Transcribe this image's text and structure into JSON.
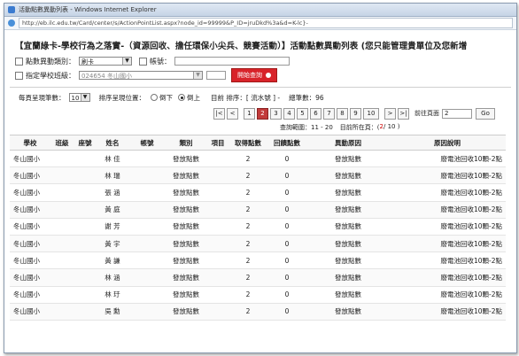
{
  "window": {
    "title": "活動點數異動列表 - Windows Internet Explorer"
  },
  "address": {
    "url": "http://eb.ilc.edu.tw/Card/center/s/ActionPointList.aspx?node_id=99999&P_ID=jruDkd%3a&d=K-lc}-"
  },
  "page": {
    "title": "【宜蘭綠卡-學校行為之落實-（資源回收、擔任環保小尖兵、競賽活動）】活動點數異動列表 (您只能管理貴單位及您新增"
  },
  "filters": {
    "type_label": "點數異動類別：",
    "type_value": "刷卡",
    "account_label": "帳號：",
    "school_label": "指定學校班級：",
    "school_value": "024654 冬山國小",
    "search_button": "開始查詢"
  },
  "options": {
    "page_size_label": "每頁呈現筆數：",
    "page_size_value": "10",
    "order_label": "排序呈現位置：",
    "order_desc": "倒下",
    "order_asc": "倒上",
    "sort_text": "目前 排序：[ 流水號 ] -",
    "total_text": "總筆數：96"
  },
  "pager": {
    "first": "|<",
    "prev": "<",
    "pages": [
      "1",
      "2",
      "3",
      "4",
      "5",
      "6",
      "7",
      "8",
      "9",
      "10"
    ],
    "current": "2",
    "next": ">",
    "last": ">|",
    "goto_label": "前往頁面",
    "goto_value": "2",
    "go_button": "Go"
  },
  "info": {
    "range_label": "查詢範圍：11 - 20",
    "page_label": "目前所在頁：(",
    "page_value": "2",
    "page_total": "/ 10 )"
  },
  "table": {
    "headers": [
      "學校",
      "班級",
      "座號",
      "姓名",
      "帳號",
      "類別",
      "項目",
      "取得點數",
      "回饋點數",
      "異動原因",
      "原因說明"
    ],
    "rows": [
      [
        "冬山國小",
        "林 佳",
        "發放點數",
        "2",
        "0",
        "發放點數",
        "廢電池回收10顆-2點"
      ],
      [
        "冬山國小",
        "林 瑞",
        "發放點數",
        "2",
        "0",
        "發放點數",
        "廢電池回收10顆-2點"
      ],
      [
        "冬山國小",
        "張 涵",
        "發放點數",
        "2",
        "0",
        "發放點數",
        "廢電池回收10顆-2點"
      ],
      [
        "冬山國小",
        "黃 庭",
        "發放點數",
        "2",
        "0",
        "發放點數",
        "廢電池回收10顆-2點"
      ],
      [
        "冬山國小",
        "謝 芳",
        "發放點數",
        "2",
        "0",
        "發放點數",
        "廢電池回收10顆-2點"
      ],
      [
        "冬山國小",
        "黃 宇",
        "發放點數",
        "2",
        "0",
        "發放點數",
        "廢電池回收10顆-2點"
      ],
      [
        "冬山國小",
        "黃 謙",
        "發放點數",
        "2",
        "0",
        "發放點數",
        "廢電池回收10顆-2點"
      ],
      [
        "冬山國小",
        "林 涵",
        "發放點數",
        "2",
        "0",
        "發放點數",
        "廢電池回收10顆-2點"
      ],
      [
        "冬山國小",
        "林 玗",
        "發放點數",
        "2",
        "0",
        "發放點數",
        "廢電池回收10顆-2點"
      ],
      [
        "冬山國小",
        "吳 勳",
        "發放點數",
        "2",
        "0",
        "發放點數",
        "廢電池回收10顆-2點"
      ]
    ]
  }
}
